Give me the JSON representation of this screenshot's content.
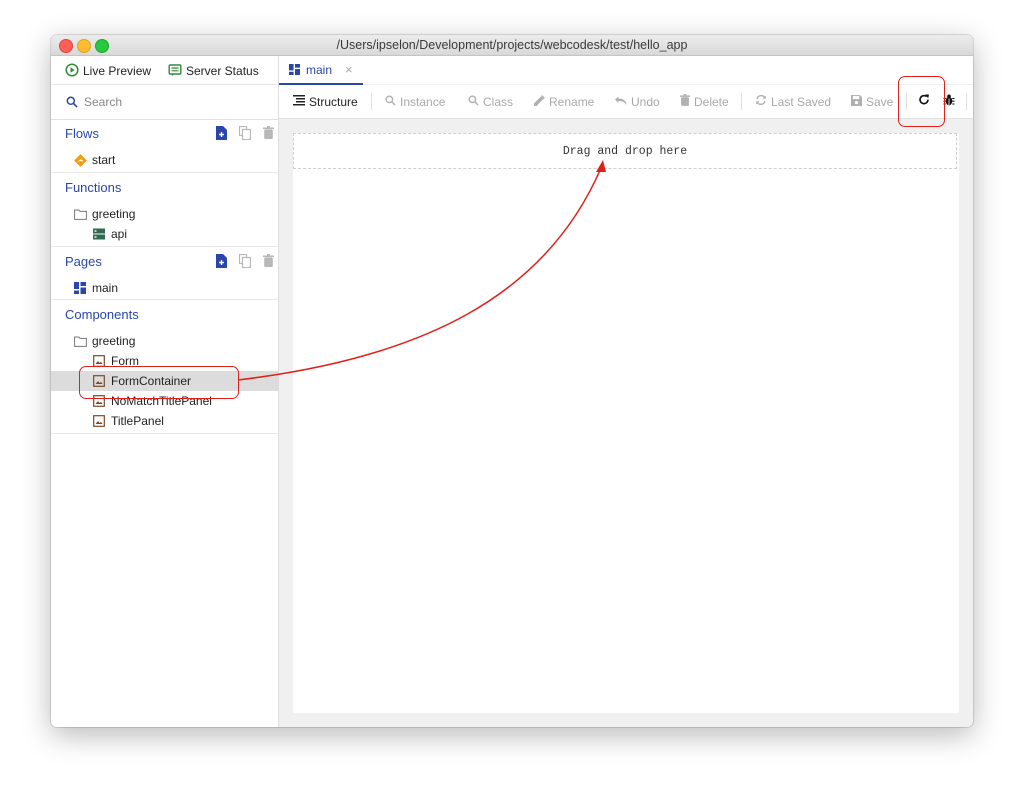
{
  "window": {
    "title": "/Users/ipselon/Development/projects/webcodesk/test/hello_app"
  },
  "sidebar": {
    "top_buttons": {
      "live_preview": "Live Preview",
      "server_status": "Server Status"
    },
    "search": {
      "placeholder": "Search"
    },
    "sections": {
      "flows": {
        "title": "Flows",
        "items": [
          "start"
        ]
      },
      "functions": {
        "title": "Functions",
        "folder": "greeting",
        "items": [
          "api"
        ]
      },
      "pages": {
        "title": "Pages",
        "items": [
          "main"
        ]
      },
      "components": {
        "title": "Components",
        "folder": "greeting",
        "items": [
          "Form",
          "FormContainer",
          "NoMatchTitlePanel",
          "TitlePanel"
        ],
        "selected": "FormContainer"
      }
    }
  },
  "tabs": [
    {
      "label": "main",
      "close": "×"
    }
  ],
  "toolbar": {
    "structure": "Structure",
    "instance": "Instance",
    "class": "Class",
    "rename": "Rename",
    "undo": "Undo",
    "delete": "Delete",
    "last_saved": "Last Saved",
    "save": "Save"
  },
  "canvas": {
    "dropzone_text": "Drag and drop here"
  },
  "colors": {
    "accent": "#2a46a8",
    "annotation": "#e0201a",
    "flow_icon": "#f39c12",
    "live_preview_icon": "#2e8b3a",
    "component_icon": "#7a4b2a",
    "function_icon": "#2e6b4f"
  }
}
